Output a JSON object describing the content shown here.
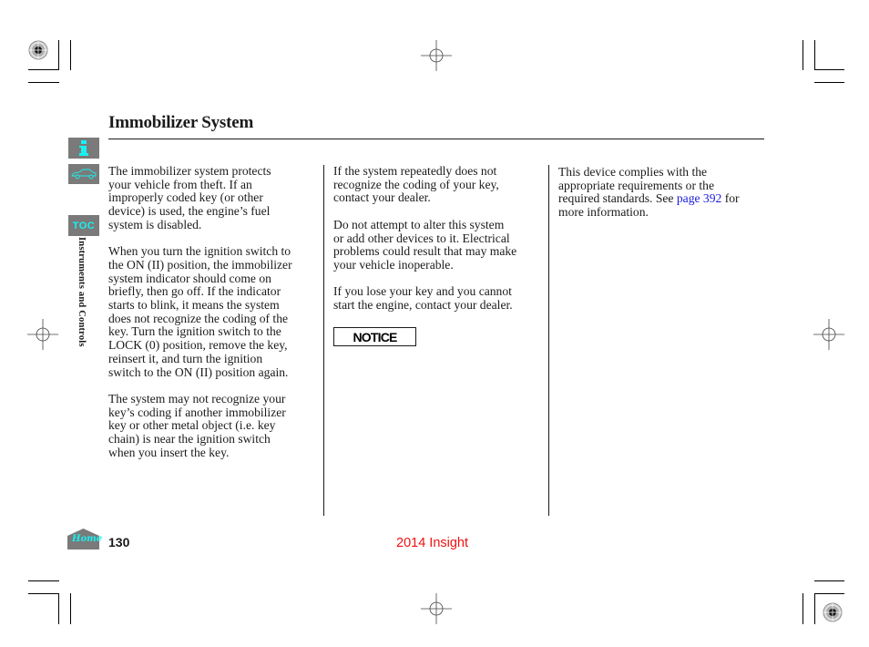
{
  "page": {
    "title": "Immobilizer System",
    "section_label": "Instruments and Controls",
    "page_number": "130",
    "footer": "2014 Insight"
  },
  "nav": {
    "info_icon": "info-icon",
    "car_icon": "vehicle-icon",
    "toc_label": "TOC",
    "home_label": "Home"
  },
  "columns": [
    {
      "paragraphs": [
        "The immobilizer system protects\nyour vehicle from theft. If an\nimproperly coded key (or other\ndevice) is used, the engine’s fuel\nsystem is disabled.",
        "When you turn the ignition switch to\nthe ON (II) position, the immobilizer\nsystem indicator should come on\nbriefly, then go off. If the indicator\nstarts to blink, it means the system\ndoes not recognize the coding of the\nkey. Turn the ignition switch to the\nLOCK (0) position, remove the key,\nreinsert it, and turn the ignition\nswitch to the ON (II) position again.",
        "The system may not recognize your\nkey’s coding if another immobilizer\nkey or other metal object (i.e. key\nchain) is near the ignition switch\nwhen you insert the key."
      ]
    },
    {
      "paragraphs": [
        "If the system repeatedly does not\nrecognize the coding of your key,\ncontact your dealer.",
        "Do not attempt to alter this system\nor add other devices to it. Electrical\nproblems could result that may make\nyour vehicle inoperable.",
        "If you lose your key and you cannot\nstart the engine, contact your dealer."
      ],
      "notice_label": "NOTICE"
    },
    {
      "text_before_link": "This device complies with the\nappropriate requirements or the\nrequired standards. See ",
      "link_text": "page 392",
      "text_after_link": " for\nmore information."
    }
  ],
  "colors": {
    "accent_cyan": "#19f0f0",
    "nav_gray": "#7a7a7a",
    "link_blue": "#1a1adc",
    "footer_red": "#ee1111"
  }
}
